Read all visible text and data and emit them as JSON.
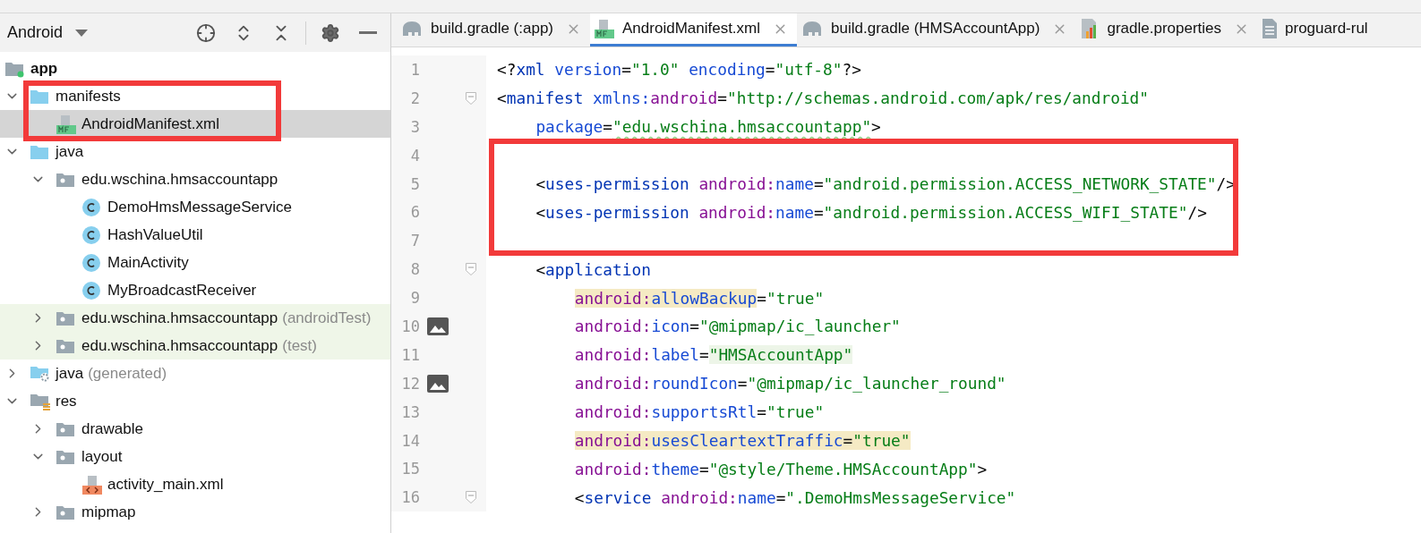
{
  "project_panel": {
    "view": "Android",
    "tree": {
      "name": "app",
      "kind": "module",
      "children": [
        {
          "name": "manifests",
          "kind": "source-folder",
          "expanded": true,
          "selected": false,
          "children": [
            {
              "name": "AndroidManifest.xml",
              "kind": "manifest-file",
              "selected": true
            }
          ]
        },
        {
          "name": "java",
          "kind": "source-folder",
          "expanded": true,
          "selected": false,
          "children": [
            {
              "name": "edu.wschina.hmsaccountapp",
              "kind": "package",
              "expanded": true,
              "selected": false,
              "children": [
                {
                  "name": "DemoHmsMessageService",
                  "kind": "class",
                  "selected": false
                },
                {
                  "name": "HashValueUtil",
                  "kind": "class",
                  "selected": false
                },
                {
                  "name": "MainActivity",
                  "kind": "class",
                  "selected": false
                },
                {
                  "name": "MyBroadcastReceiver",
                  "kind": "class",
                  "selected": false
                }
              ]
            },
            {
              "name": "edu.wschina.hmsaccountapp",
              "suffix": "(androidTest)",
              "kind": "test-package",
              "expanded": false,
              "selected": false
            },
            {
              "name": "edu.wschina.hmsaccountapp",
              "suffix": "(test)",
              "kind": "test-package",
              "expanded": false,
              "selected": false
            }
          ]
        },
        {
          "name": "java",
          "suffix": "(generated)",
          "kind": "generated-folder",
          "expanded": false,
          "selected": false
        },
        {
          "name": "res",
          "kind": "res-folder",
          "expanded": true,
          "selected": false,
          "children": [
            {
              "name": "drawable",
              "kind": "package",
              "expanded": false,
              "selected": false
            },
            {
              "name": "layout",
              "kind": "package",
              "expanded": true,
              "selected": false,
              "children": [
                {
                  "name": "activity_main.xml",
                  "kind": "layout-file",
                  "selected": false
                }
              ]
            },
            {
              "name": "mipmap",
              "kind": "package",
              "expanded": false,
              "selected": false
            }
          ]
        }
      ]
    }
  },
  "tabs": [
    {
      "label": "build.gradle (:app)",
      "kind": "gradle",
      "selected": false,
      "closable": true
    },
    {
      "label": "AndroidManifest.xml",
      "kind": "manifest",
      "selected": true,
      "closable": true
    },
    {
      "label": "build.gradle (HMSAccountApp)",
      "kind": "gradle",
      "selected": false,
      "closable": true
    },
    {
      "label": "gradle.properties",
      "kind": "properties",
      "selected": false,
      "closable": true
    },
    {
      "label": "proguard-rul",
      "kind": "text",
      "selected": false,
      "closable": false
    }
  ],
  "editor": {
    "lines": [
      {
        "number": "1",
        "fold": false,
        "image": false,
        "tokens": [
          {
            "t": "<?",
            "kind": "punct"
          },
          {
            "t": "xml",
            "kind": "tag"
          },
          {
            "t": " version",
            "kind": "attr"
          },
          {
            "t": "=",
            "kind": "punct"
          },
          {
            "t": "\"1.0\"",
            "kind": "str"
          },
          {
            "t": " encoding",
            "kind": "attr"
          },
          {
            "t": "=",
            "kind": "punct"
          },
          {
            "t": "\"utf-8\"",
            "kind": "str"
          },
          {
            "t": "?>",
            "kind": "punct"
          }
        ]
      },
      {
        "number": "2",
        "fold": true,
        "image": false,
        "tokens": [
          {
            "t": "<",
            "kind": "punct"
          },
          {
            "t": "manifest",
            "kind": "tag"
          },
          {
            "t": " xmlns:",
            "kind": "attr"
          },
          {
            "t": "android",
            "kind": "ns"
          },
          {
            "t": "=",
            "kind": "punct"
          },
          {
            "t": "\"http://schemas.android.com/apk/res/android\"",
            "kind": "str"
          }
        ],
        "children": [
          {
            "number": "3",
            "fold": false,
            "image": false,
            "tokens": [
              {
                "t": "package",
                "kind": "attr"
              },
              {
                "t": "=",
                "kind": "punct"
              },
              {
                "t": "\"edu.wschina.hmsaccountapp\"",
                "kind": "str",
                "typo": true
              },
              {
                "t": ">",
                "kind": "punct"
              }
            ]
          },
          {
            "number": "4",
            "fold": false,
            "image": false
          },
          {
            "number": "5",
            "fold": false,
            "image": false,
            "tokens": [
              {
                "t": "<",
                "kind": "punct"
              },
              {
                "t": "uses-permission",
                "kind": "tag"
              },
              {
                "t": " android:",
                "kind": "ns"
              },
              {
                "t": "name",
                "kind": "attr"
              },
              {
                "t": "=",
                "kind": "punct"
              },
              {
                "t": "\"android.permission.ACCESS_NETWORK_STATE\"",
                "kind": "str"
              },
              {
                "t": "/>",
                "kind": "punct"
              }
            ]
          },
          {
            "number": "6",
            "fold": false,
            "image": false,
            "tokens": [
              {
                "t": "<",
                "kind": "punct"
              },
              {
                "t": "uses-permission",
                "kind": "tag"
              },
              {
                "t": " android:",
                "kind": "ns"
              },
              {
                "t": "name",
                "kind": "attr"
              },
              {
                "t": "=",
                "kind": "punct"
              },
              {
                "t": "\"android.permission.ACCESS_WIFI_STATE\"",
                "kind": "str"
              },
              {
                "t": "/>",
                "kind": "punct"
              }
            ]
          },
          {
            "number": "7",
            "fold": false,
            "image": false
          },
          {
            "number": "8",
            "fold": true,
            "image": false,
            "tokens": [
              {
                "t": "<",
                "kind": "punct"
              },
              {
                "t": "application",
                "kind": "tag"
              }
            ],
            "children": [
              {
                "number": "9",
                "fold": false,
                "image": false,
                "tokens": [
                  {
                    "t": "android:",
                    "kind": "ns",
                    "warning": true
                  },
                  {
                    "t": "allowBackup",
                    "kind": "attr",
                    "warning": true
                  },
                  {
                    "t": "=",
                    "kind": "punct"
                  },
                  {
                    "t": "\"true\"",
                    "kind": "str"
                  }
                ]
              },
              {
                "number": "10",
                "fold": false,
                "image": true,
                "tokens": [
                  {
                    "t": "android:",
                    "kind": "ns"
                  },
                  {
                    "t": "icon",
                    "kind": "attr"
                  },
                  {
                    "t": "=",
                    "kind": "punct"
                  },
                  {
                    "t": "\"@mipmap/ic_launcher\"",
                    "kind": "str"
                  }
                ]
              },
              {
                "number": "11",
                "fold": false,
                "image": false,
                "tokens": [
                  {
                    "t": "android:",
                    "kind": "ns"
                  },
                  {
                    "t": "label",
                    "kind": "attr"
                  },
                  {
                    "t": "=",
                    "kind": "punct"
                  },
                  {
                    "t": "\"HMSAccountApp\"",
                    "kind": "str",
                    "resolved": true
                  }
                ]
              },
              {
                "number": "12",
                "fold": false,
                "image": true,
                "tokens": [
                  {
                    "t": "android:",
                    "kind": "ns"
                  },
                  {
                    "t": "roundIcon",
                    "kind": "attr"
                  },
                  {
                    "t": "=",
                    "kind": "punct"
                  },
                  {
                    "t": "\"@mipmap/ic_launcher_round\"",
                    "kind": "str"
                  }
                ]
              },
              {
                "number": "13",
                "fold": false,
                "image": false,
                "tokens": [
                  {
                    "t": "android:",
                    "kind": "ns"
                  },
                  {
                    "t": "supportsRtl",
                    "kind": "attr"
                  },
                  {
                    "t": "=",
                    "kind": "punct"
                  },
                  {
                    "t": "\"true\"",
                    "kind": "str"
                  }
                ]
              },
              {
                "number": "14",
                "fold": false,
                "image": false,
                "tokens": [
                  {
                    "t": "android:",
                    "kind": "ns",
                    "warning": true
                  },
                  {
                    "t": "usesCleartextTraffic",
                    "kind": "attr",
                    "warning": true
                  },
                  {
                    "t": "=",
                    "kind": "punct",
                    "warning": true
                  },
                  {
                    "t": "\"true\"",
                    "kind": "str",
                    "warning": true
                  }
                ]
              },
              {
                "number": "15",
                "fold": false,
                "image": false,
                "tokens": [
                  {
                    "t": "android:",
                    "kind": "ns"
                  },
                  {
                    "t": "theme",
                    "kind": "attr"
                  },
                  {
                    "t": "=",
                    "kind": "punct"
                  },
                  {
                    "t": "\"@style/Theme.HMSAccountApp\"",
                    "kind": "str"
                  },
                  {
                    "t": ">",
                    "kind": "punct"
                  }
                ]
              },
              {
                "number": "16",
                "fold": true,
                "image": false,
                "tokens": [
                  {
                    "t": "<",
                    "kind": "punct"
                  },
                  {
                    "t": "service",
                    "kind": "tag"
                  },
                  {
                    "t": " android:",
                    "kind": "ns"
                  },
                  {
                    "t": "name",
                    "kind": "attr"
                  },
                  {
                    "t": "=",
                    "kind": "punct"
                  },
                  {
                    "t": "\".DemoHmsMessageService\"",
                    "kind": "str"
                  }
                ]
              }
            ]
          }
        ]
      }
    ]
  },
  "annotations": [
    {
      "kind": "frame"
    },
    {
      "kind": "frame"
    }
  ]
}
